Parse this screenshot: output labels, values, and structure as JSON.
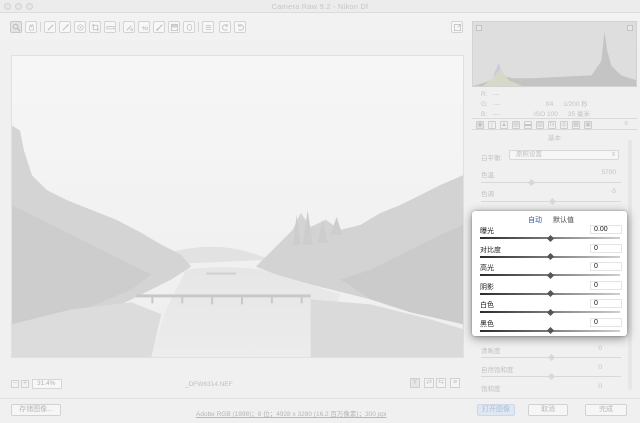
{
  "window": {
    "title": "Camera Raw 9.2 -  Nikon Df"
  },
  "toolbar": {
    "tools": [
      "zoom-tool",
      "hand-tool",
      "white-balance-tool",
      "color-sampler-tool",
      "targeted-adjustment-tool",
      "crop-tool",
      "straighten-tool",
      "spot-removal-tool",
      "red-eye-tool",
      "adjustment-brush",
      "graduated-filter",
      "radial-filter",
      "preferences",
      "rotate-left",
      "rotate-right"
    ]
  },
  "preview": {
    "zoom": "31.4%",
    "filename": "_DFW6314.NEF"
  },
  "histogram_info": {
    "r_label": "R:",
    "r_val": "---",
    "g_label": "G:",
    "g_val": "---",
    "b_label": "B:",
    "b_val": "---",
    "aperture": "f/4",
    "shutter": "1/200 秒",
    "iso": "ISO 100",
    "focal": "35 毫米"
  },
  "panel": {
    "section_title": "基本",
    "wb_label": "白平衡:",
    "wb_value": "原照设置",
    "temp_label": "色温",
    "temp_value": "5700",
    "tint_label": "色调",
    "tint_value": "-5",
    "vibrance_label": "清晰度",
    "vibrance_value": "0",
    "natural_sat_label": "自然饱和度",
    "natural_sat_value": "0",
    "sat_label": "饱和度",
    "sat_value": "0"
  },
  "popup": {
    "auto": "自动",
    "default": "默认值",
    "rows": [
      {
        "label": "曝光",
        "value": "0.00",
        "level": 0.5
      },
      {
        "label": "对比度",
        "value": "0",
        "level": 0.5
      },
      {
        "label": "高光",
        "value": "0",
        "level": 0.5
      },
      {
        "label": "阴影",
        "value": "0",
        "level": 0.5
      },
      {
        "label": "白色",
        "value": "0",
        "level": 0.5
      },
      {
        "label": "黑色",
        "value": "0",
        "level": 0.5
      }
    ]
  },
  "statusbar": {
    "save_image": "存储图像...",
    "workflow": "Adobe RGB (1998)；8 位；4928 x 3280 (16.2 百万像素)；300 ppi",
    "open_image": "打开图像",
    "cancel": "取消",
    "done": "完成"
  },
  "colors": {
    "accent_blue": "#2d5ba0",
    "dimmed_text": "#c0c0c0"
  }
}
